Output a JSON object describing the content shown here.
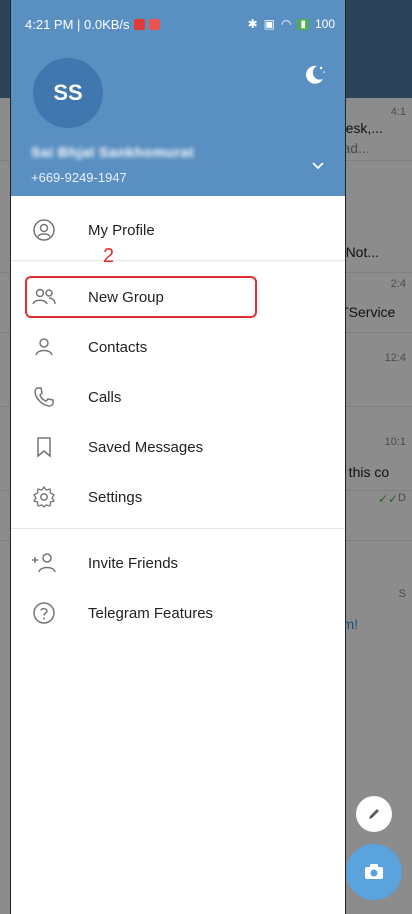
{
  "status_bar": {
    "time_speed": "4:21 PM | 0.0KB/s",
    "battery": "100"
  },
  "drawer": {
    "avatar_initials": "SS",
    "user_name": "Sai Bhjal Sankhomurat",
    "phone": "+669-9249-1947",
    "menu": [
      {
        "label": "My Profile",
        "icon": "person-circle-icon"
      },
      {
        "label": "New Group",
        "icon": "group-icon"
      },
      {
        "label": "Contacts",
        "icon": "person-icon"
      },
      {
        "label": "Calls",
        "icon": "phone-icon"
      },
      {
        "label": "Saved Messages",
        "icon": "bookmark-icon"
      },
      {
        "label": "Settings",
        "icon": "gear-icon"
      },
      {
        "label": "Invite Friends",
        "icon": "add-person-icon"
      },
      {
        "label": "Telegram Features",
        "icon": "question-circle-icon"
      }
    ]
  },
  "annotation": {
    "step_number": "2"
  },
  "background_chats": [
    {
      "time": "4:1",
      "line1": "odesk,...",
      "line2": "orad..."
    },
    {
      "time": "",
      "line1": "e_Not...",
      "line2": ""
    },
    {
      "time": "2:4",
      "line1": "CTService",
      "line2": ""
    },
    {
      "time": "12:4",
      "line1": "",
      "line2": ""
    },
    {
      "time": "10:1",
      "line1": "ve this co",
      "line2": ""
    },
    {
      "time": "D",
      "line1": "",
      "line2": ""
    },
    {
      "time": "S",
      "line1": "ram!",
      "line2": ""
    }
  ],
  "colors": {
    "header": "#5a8fc2",
    "accent_red": "#e03030",
    "fab": "#5aa3dc"
  }
}
